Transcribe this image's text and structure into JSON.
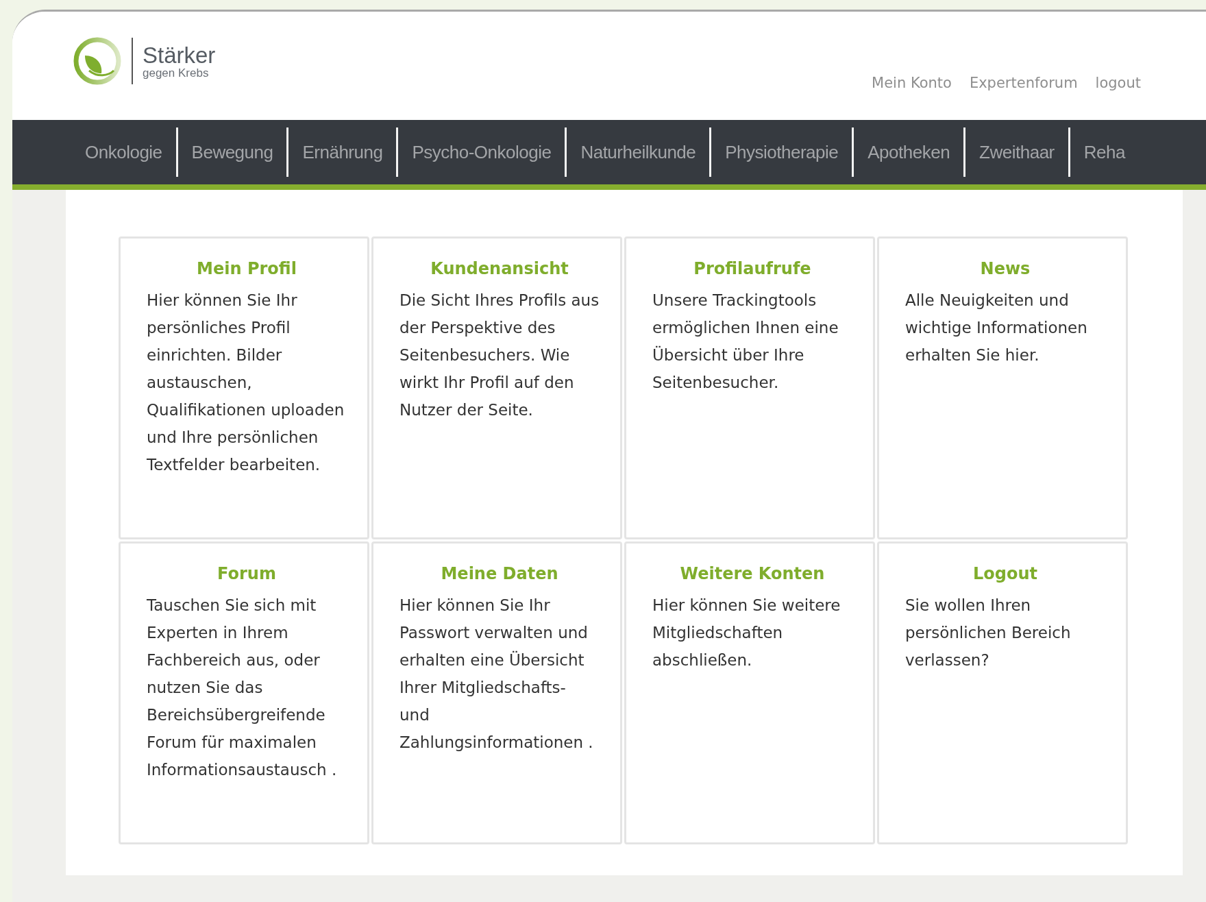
{
  "logo": {
    "title": "Stärker",
    "subtitle": "gegen Krebs"
  },
  "top_links": [
    "Mein Konto",
    "Expertenforum",
    "logout"
  ],
  "nav": [
    "Onkologie",
    "Bewegung",
    "Ernährung",
    "Psycho-Onkologie",
    "Naturheilkunde",
    "Physiotherapie",
    "Apotheken",
    "Zweithaar",
    "Reha"
  ],
  "cards": [
    {
      "title": "Mein Profil",
      "text": "Hier können Sie Ihr persönliches Profil einrichten. Bilder austauschen, Qualifikationen uploaden und Ihre persönlichen Textfelder bearbeiten."
    },
    {
      "title": "Kundenansicht",
      "text": "Die Sicht Ihres Profils aus der Perspektive des Seitenbesuchers. Wie wirkt Ihr Profil auf den Nutzer der Seite."
    },
    {
      "title": "Profilaufrufe",
      "text": "Unsere Trackingtools ermöglichen Ihnen eine Übersicht über Ihre Seitenbesucher."
    },
    {
      "title": "News",
      "text": "Alle Neuigkeiten und wichtige Informationen erhalten Sie hier."
    },
    {
      "title": "Forum",
      "text": "Tauschen Sie sich mit Experten in Ihrem Fachbereich aus, oder nutzen Sie das Bereichsübergreifende Forum für maximalen Informationsaustausch ."
    },
    {
      "title": "Meine Daten",
      "text": "Hier können Sie Ihr Passwort verwalten und erhalten eine Übersicht Ihrer Mitgliedschafts- und Zahlungsinformationen ."
    },
    {
      "title": "Weitere Konten",
      "text": "Hier können Sie weitere Mitgliedschaften abschließen."
    },
    {
      "title": "Logout",
      "text": "Sie wollen Ihren persönlichen Bereich verlassen?"
    }
  ]
}
